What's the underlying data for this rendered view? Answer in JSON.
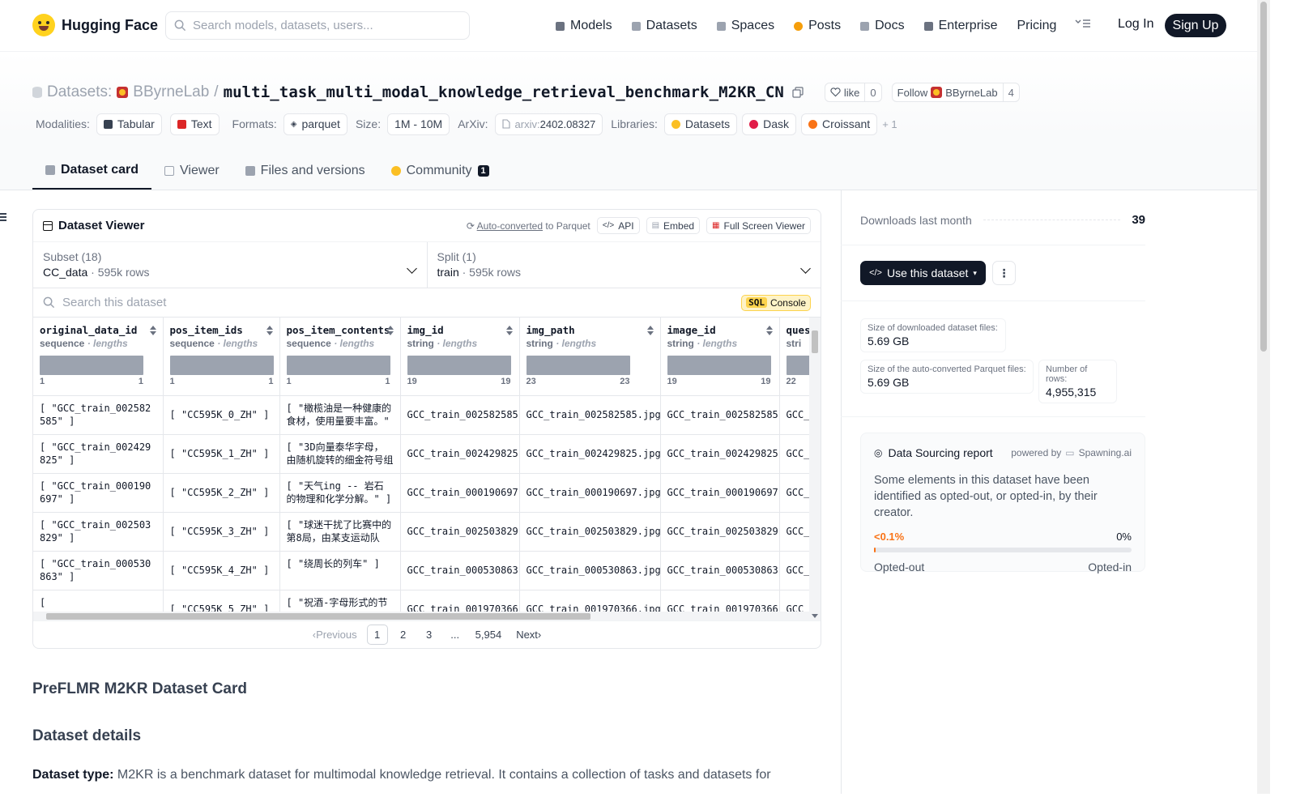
{
  "nav": {
    "brand": "Hugging Face",
    "search_placeholder": "Search models, datasets, users...",
    "links": [
      {
        "label": "Models",
        "color": "#6b7280"
      },
      {
        "label": "Datasets",
        "color": "#9ca3af"
      },
      {
        "label": "Spaces",
        "color": "#9ca3af"
      },
      {
        "label": "Posts",
        "color": "#f59e0b"
      },
      {
        "label": "Docs",
        "color": "#9ca3af"
      },
      {
        "label": "Enterprise",
        "color": "#6b7280"
      },
      {
        "label": "Pricing",
        "color": ""
      }
    ],
    "login": "Log In",
    "signup": "Sign Up"
  },
  "header": {
    "crumb_label": "Datasets:",
    "org": "BByrneLab",
    "slash": "/",
    "dataset_name": "multi_task_multi_modal_knowledge_retrieval_benchmark_M2KR_CN",
    "like_label": "like",
    "like_count": "0",
    "follow_label": "Follow",
    "follow_org": "BByrneLab",
    "follow_count": "4"
  },
  "meta": {
    "modalities_label": "Modalities:",
    "modalities": [
      {
        "label": "Tabular",
        "color": "#374151"
      },
      {
        "label": "Text",
        "color": "#dc2626"
      }
    ],
    "formats_label": "Formats:",
    "formats": [
      "parquet"
    ],
    "size_label": "Size:",
    "size": "1M - 10M",
    "arxiv_label": "ArXiv:",
    "arxiv_prefix": "arxiv:",
    "arxiv_id": "2402.08327",
    "libraries_label": "Libraries:",
    "libraries": [
      {
        "label": "Datasets",
        "color": "#fbbf24"
      },
      {
        "label": "Dask",
        "color": "#e11d48"
      },
      {
        "label": "Croissant",
        "color": "#f97316"
      }
    ],
    "more": "+ 1"
  },
  "tabs": [
    {
      "label": "Dataset card",
      "active": true
    },
    {
      "label": "Viewer"
    },
    {
      "label": "Files and versions"
    },
    {
      "label": "Community",
      "badge": "1"
    }
  ],
  "viewer": {
    "title": "Dataset Viewer",
    "auto_converted": "Auto-converted",
    "to_parquet": "to Parquet",
    "api": "API",
    "embed": "Embed",
    "fullscreen": "Full Screen Viewer",
    "subset_label": "Subset (18)",
    "subset_value": "CC_data",
    "subset_rows": "· 595k rows",
    "split_label": "Split (1)",
    "split_value": "train",
    "split_rows": "· 595k rows",
    "search_placeholder": "Search this dataset",
    "sql": "SQL",
    "console": "Console",
    "columns": [
      {
        "name": "original_data_id",
        "type": "sequence",
        "sub": "· lengths",
        "min": "1",
        "max": "1"
      },
      {
        "name": "pos_item_ids",
        "type": "sequence",
        "sub": "· lengths",
        "min": "1",
        "max": "1"
      },
      {
        "name": "pos_item_contents",
        "type": "sequence",
        "sub": "· lengths",
        "min": "1",
        "max": "1"
      },
      {
        "name": "img_id",
        "type": "string",
        "sub": "· lengths",
        "min": "19",
        "max": "19"
      },
      {
        "name": "img_path",
        "type": "string",
        "sub": "· lengths",
        "min": "23",
        "max": "23"
      },
      {
        "name": "image_id",
        "type": "string",
        "sub": "· lengths",
        "min": "19",
        "max": "19"
      },
      {
        "name": "ques",
        "type": "stri",
        "sub": "",
        "min": "22",
        "max": ""
      }
    ],
    "rows": [
      [
        "[ \"GCC_train_002582585\" ]",
        "[ \"CC595K_0_ZH\" ]",
        "[ \"橄榄油是一种健康的食材，使用量要丰富。\" ]",
        "GCC_train_002582585",
        "GCC_train_002582585.jpg",
        "GCC_train_002582585",
        "GCC_"
      ],
      [
        "[ \"GCC_train_002429825\" ]",
        "[ \"CC595K_1_ZH\" ]",
        "[ \"3D向量泰华字母，由随机旋转的细金符号组成\" ]",
        "GCC_train_002429825",
        "GCC_train_002429825.jpg",
        "GCC_train_002429825",
        "GCC_"
      ],
      [
        "[ \"GCC_train_000190697\" ]",
        "[ \"CC595K_2_ZH\" ]",
        "[ \"天气ing -- 岩石的物理和化学分解。\" ]",
        "GCC_train_000190697",
        "GCC_train_000190697.jpg",
        "GCC_train_000190697",
        "GCC_"
      ],
      [
        "[ \"GCC_train_002503829\" ]",
        "[ \"CC595K_3_ZH\" ]",
        "[ \"球迷干扰了比赛中的第8局，由某支运动队在\" ]",
        "GCC_train_002503829",
        "GCC_train_002503829.jpg",
        "GCC_train_002503829",
        "GCC_"
      ],
      [
        "[ \"GCC_train_000530863\" ]",
        "[ \"CC595K_4_ZH\" ]",
        "[ \"绕周长的列车\" ]",
        "GCC_train_000530863",
        "GCC_train_000530863.jpg",
        "GCC_train_000530863",
        "GCC_"
      ],
      [
        "[",
        "[ \"CC595K_5_ZH\" ]",
        "[ \"祝酒-字母形式的节",
        "GCC_train_001970366",
        "GCC_train_001970366.jpg",
        "GCC_train_001970366",
        "GCC_"
      ]
    ],
    "pager": {
      "previous": "Previous",
      "pages": [
        "1",
        "2",
        "3",
        "...",
        "5,954"
      ],
      "next": "Next"
    }
  },
  "card": {
    "title": "PreFLMR M2KR Dataset Card",
    "section": "Dataset details",
    "type_label": "Dataset type:",
    "type_text": " M2KR is a benchmark dataset for multimodal knowledge retrieval. It contains a collection of tasks and datasets for"
  },
  "sidebar": {
    "downloads_label": "Downloads last month",
    "downloads": "39",
    "use_label": "Use this dataset",
    "stats": [
      {
        "label": "Size of downloaded dataset files:",
        "value": "5.69 GB"
      },
      {
        "label": "Size of the auto-converted Parquet files:",
        "value": "5.69 GB"
      },
      {
        "label": "Number of rows:",
        "value": "4,955,315"
      }
    ],
    "report": {
      "title": "Data Sourcing report",
      "powered_by": "powered by",
      "provider": "Spawning.ai",
      "body": "Some elements in this dataset have been identified as opted-out, or opted-in, by their creator.",
      "opted_out_pct": "<0.1%",
      "opted_in_pct": "0%",
      "opted_out_label": "Opted-out",
      "opted_in_label": "Opted-in",
      "opted_out_fraction": 0.005
    }
  }
}
